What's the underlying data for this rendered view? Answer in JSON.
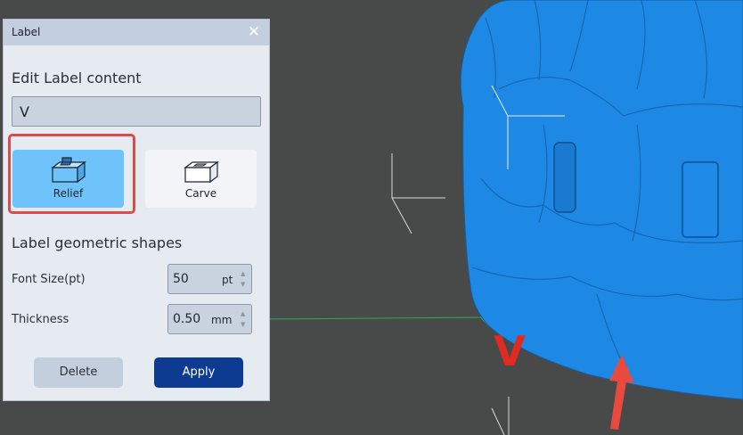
{
  "dialog": {
    "title": "Label",
    "close_glyph": "✕",
    "content_heading": "Edit Label content",
    "label_text": "V",
    "modes": [
      {
        "label": "Relief",
        "selected": true
      },
      {
        "label": "Carve",
        "selected": false
      }
    ],
    "geometry_heading": "Label geometric shapes",
    "font_size": {
      "label": "Font Size(pt)",
      "value": "50",
      "unit": "pt"
    },
    "thickness": {
      "label": "Thickness",
      "value": "0.50",
      "unit": "mm"
    },
    "delete_label": "Delete",
    "apply_label": "Apply"
  },
  "viewport": {
    "embossed_text": "V"
  },
  "colors": {
    "model": "#1e88e5",
    "relief_selected": "#6ec3fb",
    "apply": "#0e3b92",
    "highlight": "#e04a44"
  },
  "icons": [
    "close-icon",
    "relief-box-icon",
    "carve-box-icon",
    "stepper-up-icon",
    "stepper-down-icon",
    "red-arrow-annotation"
  ]
}
